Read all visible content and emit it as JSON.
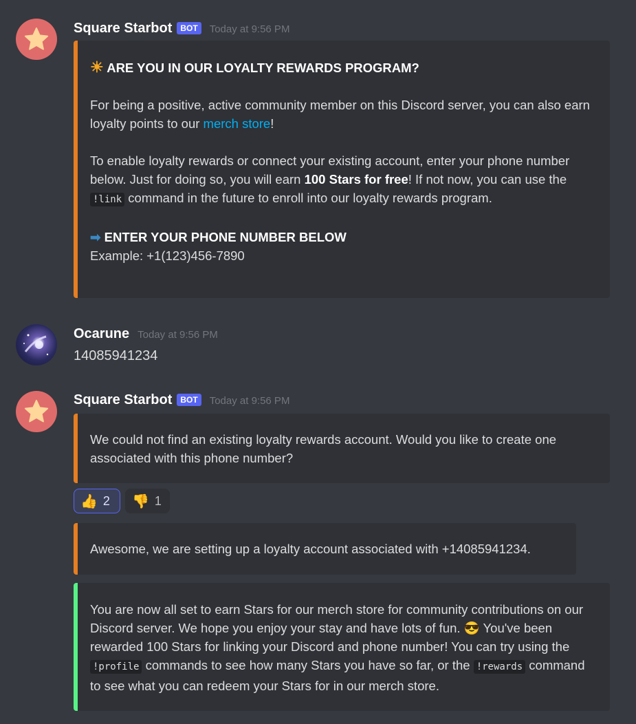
{
  "messages": {
    "m1": {
      "author": "Square Starbot",
      "bot_tag": "BOT",
      "timestamp": "Today at 9:56 PM",
      "embed": {
        "title_icon": "☀",
        "title": "ARE YOU IN OUR LOYALTY REWARDS PROGRAM?",
        "p1_a": "For being a positive, active community member on this Discord server, you can also earn loyalty points to our ",
        "p1_link": "merch store",
        "p1_b": "!",
        "p2_a": "To enable loyalty rewards or connect your existing account, enter your phone number below. Just for doing so, you will earn ",
        "p2_bold": "100 Stars for free",
        "p2_b": "! If not now, you can use the ",
        "p2_code": "!link",
        "p2_c": " command in the future to enroll into our loyalty rewards program.",
        "sub_icon": "➡",
        "sub_title": "ENTER YOUR PHONE NUMBER BELOW",
        "example": "Example: +1(123)456-7890"
      }
    },
    "m2": {
      "author": "Ocarune",
      "timestamp": "Today at 9:56 PM",
      "content": "14085941234"
    },
    "m3": {
      "author": "Square Starbot",
      "bot_tag": "BOT",
      "timestamp": "Today at 9:56 PM",
      "embed1": "We could not find an existing loyalty rewards account. Would you like to create one associated with this phone number?",
      "reactions": [
        {
          "emoji": "👍",
          "count": "2",
          "me": true
        },
        {
          "emoji": "👎",
          "count": "1",
          "me": false
        }
      ],
      "embed2": "Awesome, we are setting up a loyalty account associated with +14085941234.",
      "embed3": {
        "a": "You are now all set to earn Stars for our merch store for community contributions on our Discord server. We hope you enjoy your stay and have lots of fun. ",
        "emoji": "😎",
        "b": " You've been rewarded 100 Stars for linking your Discord and phone number! You can try using the ",
        "code1": "!profile",
        "c": " commands to see how many Stars you have so far, or the ",
        "code2": "!rewards",
        "d": " command to see what you can redeem your Stars for in our merch store."
      }
    }
  },
  "colors": {
    "background": "#36393f",
    "embed_bg": "#2f3136",
    "accent_orange": "#e67e22",
    "accent_green": "#57f287",
    "bot_tag": "#5865f2",
    "link": "#00aff4"
  },
  "icons": {
    "bot_avatar": "star-icon",
    "user_avatar": "galaxy-avatar"
  }
}
